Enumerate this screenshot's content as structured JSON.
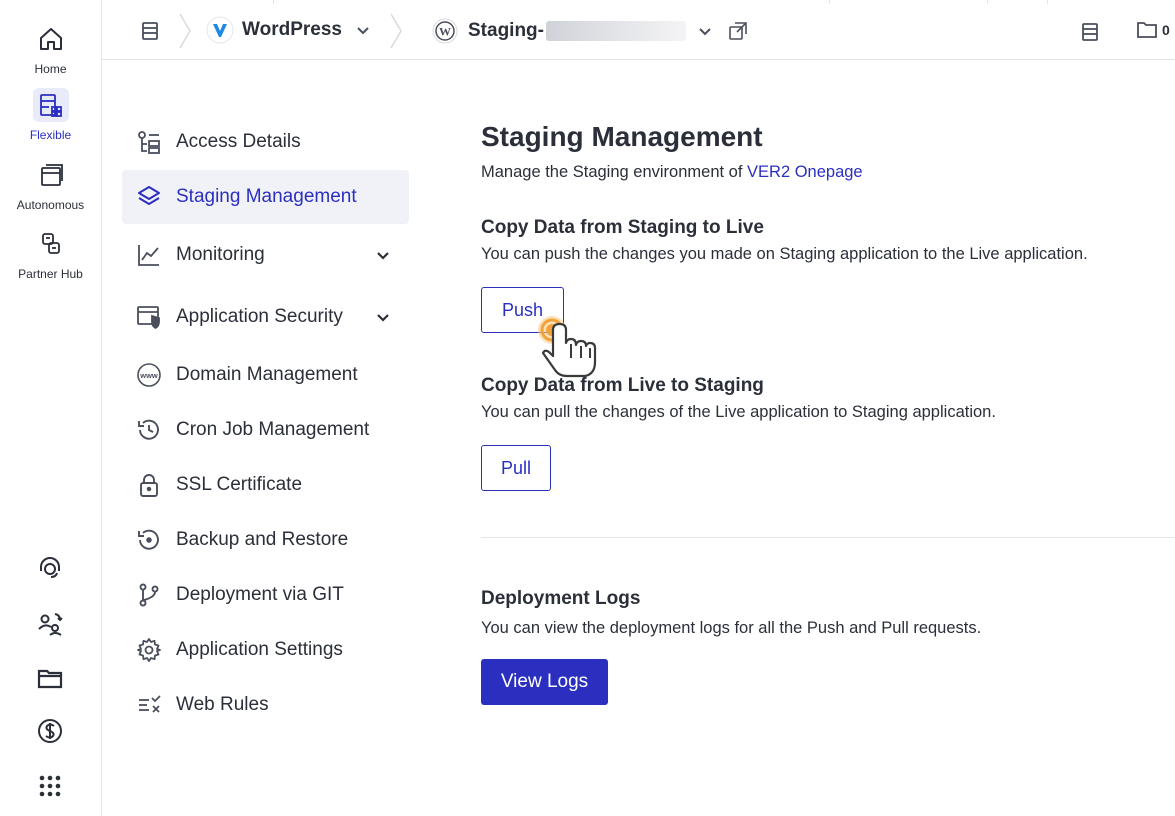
{
  "rail": {
    "items": [
      {
        "label": "Home",
        "icon": "home-icon"
      },
      {
        "label": "Flexible",
        "icon": "flexible-icon"
      },
      {
        "label": "Autonomous",
        "icon": "autonomous-icon"
      },
      {
        "label": "Partner Hub",
        "icon": "partner-hub-icon"
      }
    ],
    "bottom_icons": [
      "support-agent-icon",
      "user-switch-icon",
      "folder-icon",
      "billing-dollar-icon",
      "apps-grid-icon"
    ],
    "accent": "#2b2fc0"
  },
  "topbar": {
    "app_name": "WordPress",
    "server_name": "Staging-",
    "folder_count": "0"
  },
  "subnav": {
    "items": [
      {
        "label": "Access Details",
        "icon": "access-details-icon"
      },
      {
        "label": "Staging Management",
        "icon": "layers-icon",
        "active": true
      },
      {
        "label": "Monitoring",
        "icon": "chart-line-icon",
        "expandable": true
      },
      {
        "label": "Application Security",
        "icon": "shield-window-icon",
        "expandable": true
      },
      {
        "label": "Domain Management",
        "icon": "www-globe-icon"
      },
      {
        "label": "Cron Job Management",
        "icon": "clock-history-icon"
      },
      {
        "label": "SSL Certificate",
        "icon": "lock-icon"
      },
      {
        "label": "Backup and Restore",
        "icon": "backup-restore-icon"
      },
      {
        "label": "Deployment via GIT",
        "icon": "git-branch-icon"
      },
      {
        "label": "Application Settings",
        "icon": "gear-icon"
      },
      {
        "label": "Web Rules",
        "icon": "web-rules-icon"
      }
    ]
  },
  "main": {
    "title": "Staging Management",
    "subtitle_prefix": "Manage the Staging environment of ",
    "subtitle_link": "VER2 Onepage",
    "push_section": {
      "heading": "Copy Data from Staging to Live",
      "text": "You can push the changes you made on Staging application to the Live application.",
      "button": "Push"
    },
    "pull_section": {
      "heading": "Copy Data from Live to Staging",
      "text": "You can pull the changes of the Live application to Staging application.",
      "button": "Pull"
    },
    "logs_section": {
      "heading": "Deployment Logs",
      "text": "You can view the deployment logs for all the Push and Pull requests.",
      "button": "View Logs"
    }
  }
}
